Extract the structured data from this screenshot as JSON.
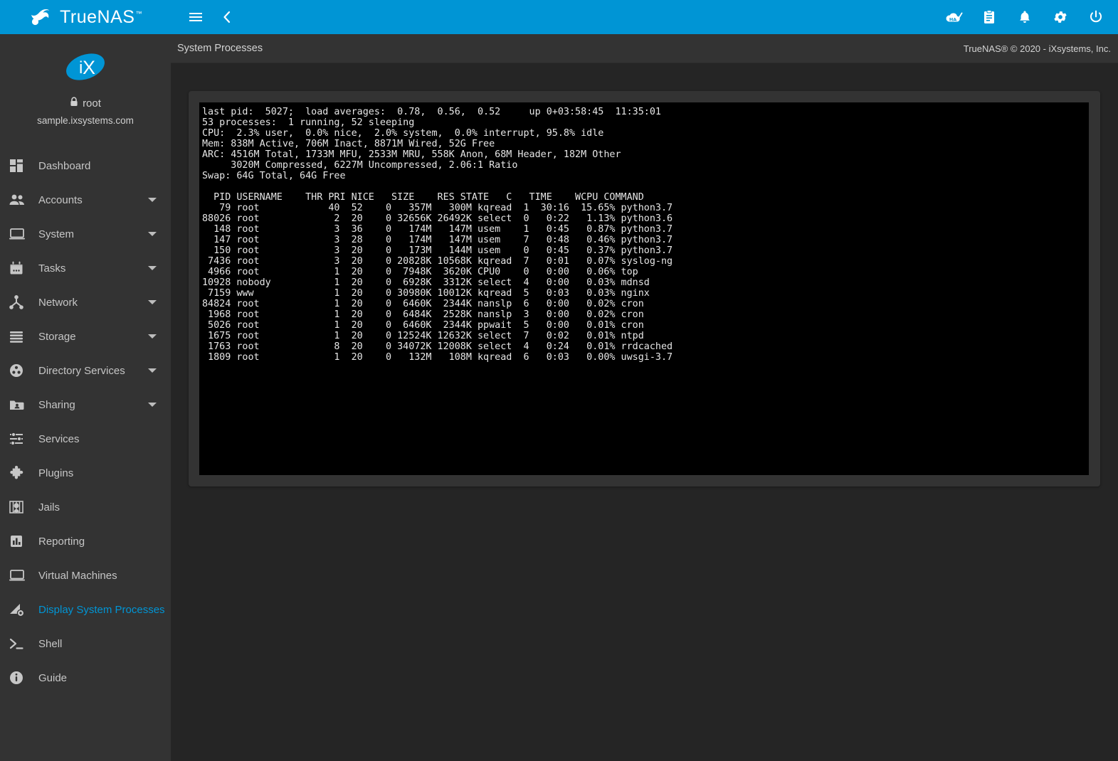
{
  "topbar": {
    "brand_name": "TrueNAS",
    "brand_tm": "™",
    "icons": {
      "menu": "hamburger-menu-icon",
      "back": "chevron-left-icon",
      "ha": "ha-cloud-check-icon",
      "tasks": "clipboard-icon",
      "alerts": "bell-icon",
      "settings": "gear-icon",
      "power": "power-icon"
    }
  },
  "sidebar": {
    "logo": "ix-systems-logo",
    "username": "root",
    "hostname": "sample.ixsystems.com",
    "items": [
      {
        "label": "Dashboard",
        "icon": "dashboard-icon",
        "expandable": false,
        "active": false
      },
      {
        "label": "Accounts",
        "icon": "people-icon",
        "expandable": true,
        "active": false
      },
      {
        "label": "System",
        "icon": "laptop-icon",
        "expandable": true,
        "active": false
      },
      {
        "label": "Tasks",
        "icon": "calendar-icon",
        "expandable": true,
        "active": false
      },
      {
        "label": "Network",
        "icon": "network-nodes-icon",
        "expandable": true,
        "active": false
      },
      {
        "label": "Storage",
        "icon": "storage-stack-icon",
        "expandable": true,
        "active": false
      },
      {
        "label": "Directory Services",
        "icon": "directory-services-icon",
        "expandable": true,
        "active": false
      },
      {
        "label": "Sharing",
        "icon": "folder-share-icon",
        "expandable": true,
        "active": false
      },
      {
        "label": "Services",
        "icon": "sliders-icon",
        "expandable": false,
        "active": false
      },
      {
        "label": "Plugins",
        "icon": "puzzle-piece-icon",
        "expandable": false,
        "active": false
      },
      {
        "label": "Jails",
        "icon": "jail-cell-icon",
        "expandable": false,
        "active": false
      },
      {
        "label": "Reporting",
        "icon": "bar-chart-icon",
        "expandable": false,
        "active": false
      },
      {
        "label": "Virtual Machines",
        "icon": "monitor-icon",
        "expandable": false,
        "active": false
      },
      {
        "label": "Display System Processes",
        "icon": "processes-gear-icon",
        "expandable": false,
        "active": true
      },
      {
        "label": "Shell",
        "icon": "terminal-prompt-icon",
        "expandable": false,
        "active": false
      },
      {
        "label": "Guide",
        "icon": "info-circle-icon",
        "expandable": false,
        "active": false
      }
    ]
  },
  "page": {
    "breadcrumb": "System Processes",
    "copyright": "TrueNAS® © 2020 - iXsystems, Inc."
  },
  "terminal": {
    "summary": {
      "last_pid": "5027",
      "load_averages": [
        "0.78",
        "0.56",
        "0.52"
      ],
      "uptime": "0+03:58:45",
      "clock": "11:35:01",
      "processes_total": "53",
      "processes_running": "1",
      "processes_sleeping": "52",
      "cpu_user": "2.3%",
      "cpu_nice": "0.0%",
      "cpu_system": "2.0%",
      "cpu_interrupt": "0.0%",
      "cpu_idle": "95.8%",
      "mem_active": "838M",
      "mem_inact": "706M",
      "mem_wired": "8871M",
      "mem_free": "52G",
      "arc_total": "4516M",
      "arc_mfu": "1733M",
      "arc_mru": "2533M",
      "arc_anon": "558K",
      "arc_header": "68M",
      "arc_other": "182M",
      "arc_compressed": "3020M",
      "arc_uncompressed": "6227M",
      "arc_ratio": "2.06:1",
      "swap_total": "64G",
      "swap_free": "64G"
    },
    "header_lines": [
      "last pid:  5027;  load averages:  0.78,  0.56,  0.52     up 0+03:58:45  11:35:01",
      "53 processes:  1 running, 52 sleeping",
      "CPU:  2.3% user,  0.0% nice,  2.0% system,  0.0% interrupt, 95.8% idle",
      "Mem: 838M Active, 706M Inact, 8871M Wired, 52G Free",
      "ARC: 4516M Total, 1733M MFU, 2533M MRU, 558K Anon, 68M Header, 182M Other",
      "     3020M Compressed, 6227M Uncompressed, 2.06:1 Ratio",
      "Swap: 64G Total, 64G Free"
    ],
    "columns": [
      "PID",
      "USERNAME",
      "THR",
      "PRI",
      "NICE",
      "SIZE",
      "RES",
      "STATE",
      "C",
      "TIME",
      "WCPU",
      "COMMAND"
    ],
    "column_header_line": "  PID USERNAME    THR PRI NICE   SIZE    RES STATE   C   TIME    WCPU COMMAND",
    "rows": [
      {
        "pid": "79",
        "username": "root",
        "thr": "40",
        "pri": "52",
        "nice": "0",
        "size": "357M",
        "res": "300M",
        "state": "kqread",
        "c": "1",
        "time": "30:16",
        "wcpu": "15.65%",
        "command": "python3.7"
      },
      {
        "pid": "88026",
        "username": "root",
        "thr": "2",
        "pri": "20",
        "nice": "0",
        "size": "32656K",
        "res": "26492K",
        "state": "select",
        "c": "0",
        "time": "0:22",
        "wcpu": "1.13%",
        "command": "python3.6"
      },
      {
        "pid": "148",
        "username": "root",
        "thr": "3",
        "pri": "36",
        "nice": "0",
        "size": "174M",
        "res": "147M",
        "state": "usem",
        "c": "1",
        "time": "0:45",
        "wcpu": "0.87%",
        "command": "python3.7"
      },
      {
        "pid": "147",
        "username": "root",
        "thr": "3",
        "pri": "28",
        "nice": "0",
        "size": "174M",
        "res": "147M",
        "state": "usem",
        "c": "7",
        "time": "0:48",
        "wcpu": "0.46%",
        "command": "python3.7"
      },
      {
        "pid": "150",
        "username": "root",
        "thr": "3",
        "pri": "20",
        "nice": "0",
        "size": "173M",
        "res": "144M",
        "state": "usem",
        "c": "0",
        "time": "0:45",
        "wcpu": "0.37%",
        "command": "python3.7"
      },
      {
        "pid": "7436",
        "username": "root",
        "thr": "3",
        "pri": "20",
        "nice": "0",
        "size": "20828K",
        "res": "10568K",
        "state": "kqread",
        "c": "7",
        "time": "0:01",
        "wcpu": "0.07%",
        "command": "syslog-ng"
      },
      {
        "pid": "4966",
        "username": "root",
        "thr": "1",
        "pri": "20",
        "nice": "0",
        "size": "7948K",
        "res": "3620K",
        "state": "CPU0",
        "c": "0",
        "time": "0:00",
        "wcpu": "0.06%",
        "command": "top"
      },
      {
        "pid": "10928",
        "username": "nobody",
        "thr": "1",
        "pri": "20",
        "nice": "0",
        "size": "6928K",
        "res": "3312K",
        "state": "select",
        "c": "4",
        "time": "0:00",
        "wcpu": "0.03%",
        "command": "mdnsd"
      },
      {
        "pid": "7159",
        "username": "www",
        "thr": "1",
        "pri": "20",
        "nice": "0",
        "size": "30980K",
        "res": "10012K",
        "state": "kqread",
        "c": "5",
        "time": "0:03",
        "wcpu": "0.03%",
        "command": "nginx"
      },
      {
        "pid": "84824",
        "username": "root",
        "thr": "1",
        "pri": "20",
        "nice": "0",
        "size": "6460K",
        "res": "2344K",
        "state": "nanslp",
        "c": "6",
        "time": "0:00",
        "wcpu": "0.02%",
        "command": "cron"
      },
      {
        "pid": "1968",
        "username": "root",
        "thr": "1",
        "pri": "20",
        "nice": "0",
        "size": "6484K",
        "res": "2528K",
        "state": "nanslp",
        "c": "3",
        "time": "0:00",
        "wcpu": "0.02%",
        "command": "cron"
      },
      {
        "pid": "5026",
        "username": "root",
        "thr": "1",
        "pri": "20",
        "nice": "0",
        "size": "6460K",
        "res": "2344K",
        "state": "ppwait",
        "c": "5",
        "time": "0:00",
        "wcpu": "0.01%",
        "command": "cron"
      },
      {
        "pid": "1675",
        "username": "root",
        "thr": "1",
        "pri": "20",
        "nice": "0",
        "size": "12524K",
        "res": "12632K",
        "state": "select",
        "c": "7",
        "time": "0:02",
        "wcpu": "0.01%",
        "command": "ntpd"
      },
      {
        "pid": "1763",
        "username": "root",
        "thr": "8",
        "pri": "20",
        "nice": "0",
        "size": "34072K",
        "res": "12008K",
        "state": "select",
        "c": "4",
        "time": "0:24",
        "wcpu": "0.01%",
        "command": "rrdcached"
      },
      {
        "pid": "1809",
        "username": "root",
        "thr": "1",
        "pri": "20",
        "nice": "0",
        "size": "132M",
        "res": "108M",
        "state": "kqread",
        "c": "6",
        "time": "0:03",
        "wcpu": "0.00%",
        "command": "uwsgi-3.7"
      }
    ],
    "row_lines": [
      "   79 root            40  52    0   357M   300M kqread  1  30:16  15.65% python3.7",
      "88026 root             2  20    0 32656K 26492K select  0   0:22   1.13% python3.6",
      "  148 root             3  36    0   174M   147M usem    1   0:45   0.87% python3.7",
      "  147 root             3  28    0   174M   147M usem    7   0:48   0.46% python3.7",
      "  150 root             3  20    0   173M   144M usem    0   0:45   0.37% python3.7",
      " 7436 root             3  20    0 20828K 10568K kqread  7   0:01   0.07% syslog-ng",
      " 4966 root             1  20    0  7948K  3620K CPU0    0   0:00   0.06% top",
      "10928 nobody           1  20    0  6928K  3312K select  4   0:00   0.03% mdnsd",
      " 7159 www              1  20    0 30980K 10012K kqread  5   0:03   0.03% nginx",
      "84824 root             1  20    0  6460K  2344K nanslp  6   0:00   0.02% cron",
      " 1968 root             1  20    0  6484K  2528K nanslp  3   0:00   0.02% cron",
      " 5026 root             1  20    0  6460K  2344K ppwait  5   0:00   0.01% cron",
      " 1675 root             1  20    0 12524K 12632K select  7   0:02   0.01% ntpd",
      " 1763 root             8  20    0 34072K 12008K select  4   0:24   0.01% rrdcached",
      " 1809 root             1  20    0   132M   108M kqread  6   0:03   0.00% uwsgi-3.7"
    ]
  },
  "colors": {
    "accent": "#0095d5",
    "sidebar_bg": "#333333",
    "content_bg": "#252525",
    "terminal_bg": "#000000",
    "terminal_fg": "#e6e6e6"
  }
}
